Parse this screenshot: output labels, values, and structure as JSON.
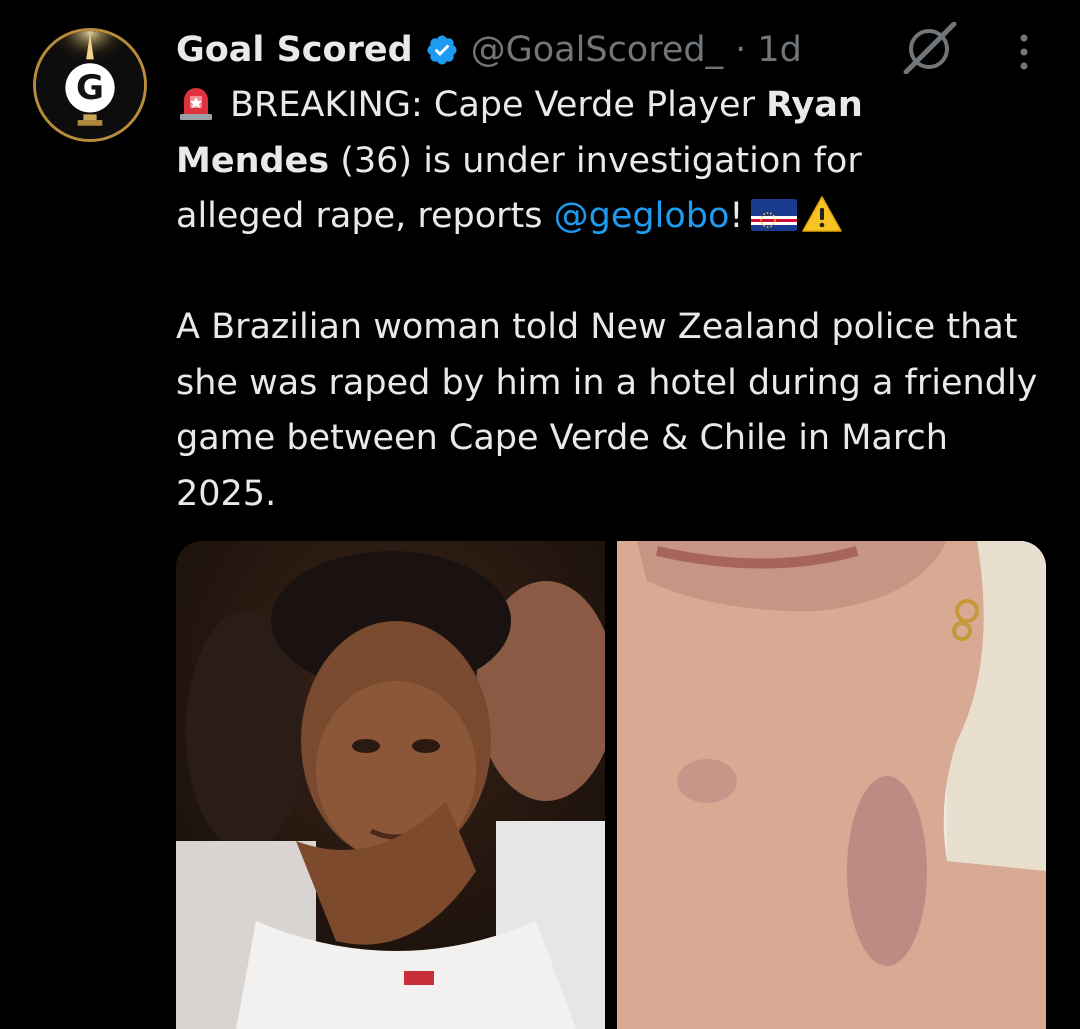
{
  "author": {
    "name": "Goal Scored",
    "handle": "@GoalScored_",
    "time": "· 1d",
    "avatar_letter": "G"
  },
  "tweet": {
    "line1_prefix": "BREAKING: Cape Verde Player ",
    "line1_bold": "Ryan",
    "line2_bold": "Mendes",
    "line2_rest": " (36) is under investigation for",
    "line3_prefix": "alleged rape, reports ",
    "line3_mention": "@geglobo",
    "line3_suffix": "!",
    "para2": "A Brazilian woman told New Zealand police that she was raped by him in a hotel during a friendly game between Cape Verde & Chile in March 2025."
  },
  "icons": {
    "verified": "verified-badge-icon",
    "grok": "grok-icon",
    "more": "more-options-icon",
    "siren": "siren-emoji-icon",
    "flag": "cape-verde-flag-icon",
    "warning": "warning-emoji-icon"
  },
  "media": [
    {
      "alt": "photo-player"
    },
    {
      "alt": "photo-neck"
    }
  ],
  "colors": {
    "background": "#000000",
    "text": "#e7e9ea",
    "secondary": "#71767b",
    "link": "#1d9bf0",
    "verified": "#1d9bf0",
    "avatar_ring": "#b98b3c"
  }
}
